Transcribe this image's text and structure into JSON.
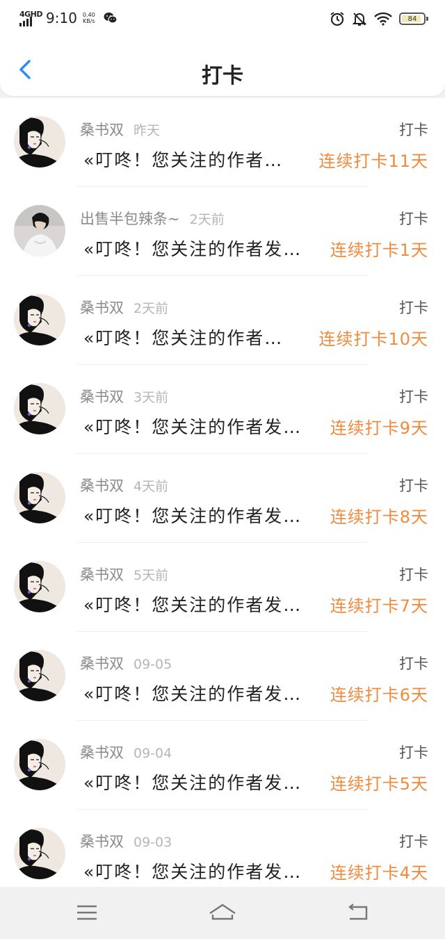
{
  "status_bar": {
    "network": "4GHD",
    "time": "9:10",
    "speed_value": "0.40",
    "speed_unit": "KB/s",
    "battery": "84",
    "icons": [
      "signal-icon",
      "wechat-icon",
      "alarm-icon",
      "mute-icon",
      "wifi-icon",
      "battery-icon"
    ]
  },
  "header": {
    "title": "打卡",
    "back_icon": "chevron-left-icon"
  },
  "colors": {
    "accent": "#f08a3c",
    "back": "#2f8df0"
  },
  "feed": [
    {
      "name": "桑书双",
      "time": "昨天",
      "tag": "打卡",
      "message": "«叮咚！您关注的作者…",
      "streak": "连续打卡11天",
      "avatar": "woman"
    },
    {
      "name": "出售半包辣条~",
      "time": "2天前",
      "tag": "打卡",
      "message": "«叮咚！您关注的作者发…",
      "streak": "连续打卡1天",
      "avatar": "man"
    },
    {
      "name": "桑书双",
      "time": "2天前",
      "tag": "打卡",
      "message": "«叮咚！您关注的作者…",
      "streak": "连续打卡10天",
      "avatar": "woman"
    },
    {
      "name": "桑书双",
      "time": "3天前",
      "tag": "打卡",
      "message": "«叮咚！您关注的作者发…",
      "streak": "连续打卡9天",
      "avatar": "woman"
    },
    {
      "name": "桑书双",
      "time": "4天前",
      "tag": "打卡",
      "message": "«叮咚！您关注的作者发…",
      "streak": "连续打卡8天",
      "avatar": "woman"
    },
    {
      "name": "桑书双",
      "time": "5天前",
      "tag": "打卡",
      "message": "«叮咚！您关注的作者发…",
      "streak": "连续打卡7天",
      "avatar": "woman"
    },
    {
      "name": "桑书双",
      "time": "09-05",
      "tag": "打卡",
      "message": "«叮咚！您关注的作者发…",
      "streak": "连续打卡6天",
      "avatar": "woman"
    },
    {
      "name": "桑书双",
      "time": "09-04",
      "tag": "打卡",
      "message": "«叮咚！您关注的作者发…",
      "streak": "连续打卡5天",
      "avatar": "woman"
    },
    {
      "name": "桑书双",
      "time": "09-03",
      "tag": "打卡",
      "message": "«叮咚！您关注的作者发…",
      "streak": "连续打卡4天",
      "avatar": "woman"
    }
  ],
  "nav": {
    "icons": [
      "menu-icon",
      "home-icon",
      "back-icon"
    ]
  }
}
